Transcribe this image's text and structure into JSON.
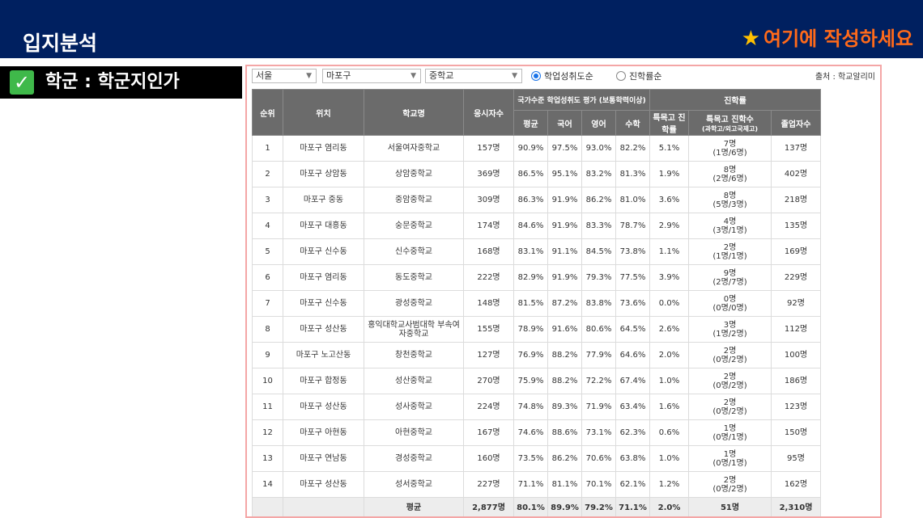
{
  "header": {
    "title": "입지분석",
    "hint": "여기에 작성하세요",
    "star_icon": "star-icon"
  },
  "subhead": {
    "label": "학군 : 학군지인가",
    "icon": "check-icon",
    "check_char": "✓"
  },
  "filters": {
    "city": "서울",
    "district": "마포구",
    "school_level": "중학교",
    "radio_achievement": "학업성취도순",
    "radio_advancement": "진학률순",
    "source": "출처 : 학교알리미"
  },
  "table_headers": {
    "rank": "순위",
    "location": "위치",
    "school": "학교명",
    "applicants": "응시자수",
    "national_group": "국가수준 학업성취도 평가 (보통학력이상)",
    "average": "평균",
    "korean": "국어",
    "english": "영어",
    "math": "수학",
    "advancement_group": "진학률",
    "special_rate": "특목고 진학률",
    "special_count": "특목고 진학수",
    "special_count_sub": "(과학고/외고국제고)",
    "graduates": "졸업자수"
  },
  "rows": [
    {
      "rank": "1",
      "location": "마포구 염리동",
      "school": "서울여자중학교",
      "applicants": "157명",
      "avg": "90.9%",
      "kor": "97.5%",
      "eng": "93.0%",
      "math": "82.2%",
      "rate": "5.1%",
      "count": "7명",
      "count_detail": "(1명/6명)",
      "grads": "137명"
    },
    {
      "rank": "2",
      "location": "마포구 상암동",
      "school": "상암중학교",
      "applicants": "369명",
      "avg": "86.5%",
      "kor": "95.1%",
      "eng": "83.2%",
      "math": "81.3%",
      "rate": "1.9%",
      "count": "8명",
      "count_detail": "(2명/6명)",
      "grads": "402명"
    },
    {
      "rank": "3",
      "location": "마포구 중동",
      "school": "중암중학교",
      "applicants": "309명",
      "avg": "86.3%",
      "kor": "91.9%",
      "eng": "86.2%",
      "math": "81.0%",
      "rate": "3.6%",
      "count": "8명",
      "count_detail": "(5명/3명)",
      "grads": "218명"
    },
    {
      "rank": "4",
      "location": "마포구 대흥동",
      "school": "숭문중학교",
      "applicants": "174명",
      "avg": "84.6%",
      "kor": "91.9%",
      "eng": "83.3%",
      "math": "78.7%",
      "rate": "2.9%",
      "count": "4명",
      "count_detail": "(3명/1명)",
      "grads": "135명"
    },
    {
      "rank": "5",
      "location": "마포구 신수동",
      "school": "신수중학교",
      "applicants": "168명",
      "avg": "83.1%",
      "kor": "91.1%",
      "eng": "84.5%",
      "math": "73.8%",
      "rate": "1.1%",
      "count": "2명",
      "count_detail": "(1명/1명)",
      "grads": "169명"
    },
    {
      "rank": "6",
      "location": "마포구 염리동",
      "school": "동도중학교",
      "applicants": "222명",
      "avg": "82.9%",
      "kor": "91.9%",
      "eng": "79.3%",
      "math": "77.5%",
      "rate": "3.9%",
      "count": "9명",
      "count_detail": "(2명/7명)",
      "grads": "229명"
    },
    {
      "rank": "7",
      "location": "마포구 신수동",
      "school": "광성중학교",
      "applicants": "148명",
      "avg": "81.5%",
      "kor": "87.2%",
      "eng": "83.8%",
      "math": "73.6%",
      "rate": "0.0%",
      "count": "0명",
      "count_detail": "(0명/0명)",
      "grads": "92명"
    },
    {
      "rank": "8",
      "location": "마포구 성산동",
      "school": "홍익대학교사범대학 부속여자중학교",
      "applicants": "155명",
      "avg": "78.9%",
      "kor": "91.6%",
      "eng": "80.6%",
      "math": "64.5%",
      "rate": "2.6%",
      "count": "3명",
      "count_detail": "(1명/2명)",
      "grads": "112명"
    },
    {
      "rank": "9",
      "location": "마포구 노고산동",
      "school": "창천중학교",
      "applicants": "127명",
      "avg": "76.9%",
      "kor": "88.2%",
      "eng": "77.9%",
      "math": "64.6%",
      "rate": "2.0%",
      "count": "2명",
      "count_detail": "(0명/2명)",
      "grads": "100명"
    },
    {
      "rank": "10",
      "location": "마포구 합정동",
      "school": "성산중학교",
      "applicants": "270명",
      "avg": "75.9%",
      "kor": "88.2%",
      "eng": "72.2%",
      "math": "67.4%",
      "rate": "1.0%",
      "count": "2명",
      "count_detail": "(0명/2명)",
      "grads": "186명"
    },
    {
      "rank": "11",
      "location": "마포구 성산동",
      "school": "성사중학교",
      "applicants": "224명",
      "avg": "74.8%",
      "kor": "89.3%",
      "eng": "71.9%",
      "math": "63.4%",
      "rate": "1.6%",
      "count": "2명",
      "count_detail": "(0명/2명)",
      "grads": "123명"
    },
    {
      "rank": "12",
      "location": "마포구 아현동",
      "school": "아현중학교",
      "applicants": "167명",
      "avg": "74.6%",
      "kor": "88.6%",
      "eng": "73.1%",
      "math": "62.3%",
      "rate": "0.6%",
      "count": "1명",
      "count_detail": "(0명/1명)",
      "grads": "150명"
    },
    {
      "rank": "13",
      "location": "마포구 연남동",
      "school": "경성중학교",
      "applicants": "160명",
      "avg": "73.5%",
      "kor": "86.2%",
      "eng": "70.6%",
      "math": "63.8%",
      "rate": "1.0%",
      "count": "1명",
      "count_detail": "(0명/1명)",
      "grads": "95명"
    },
    {
      "rank": "14",
      "location": "마포구 성산동",
      "school": "성서중학교",
      "applicants": "227명",
      "avg": "71.1%",
      "kor": "81.1%",
      "eng": "70.1%",
      "math": "62.1%",
      "rate": "1.2%",
      "count": "2명",
      "count_detail": "(0명/2명)",
      "grads": "162명"
    }
  ],
  "average_row": {
    "label": "평균",
    "applicants": "2,877명",
    "avg": "80.1%",
    "kor": "89.9%",
    "eng": "79.2%",
    "math": "71.1%",
    "rate": "2.0%",
    "count": "51명",
    "grads": "2,310명"
  },
  "colors": {
    "header_bg": "#002060",
    "hint_text": "#ff6a1a",
    "star": "#ffc000",
    "check_bg": "#3fb94a",
    "panel_border": "#f4a6a6",
    "table_header_bg": "#6b6b6b"
  }
}
